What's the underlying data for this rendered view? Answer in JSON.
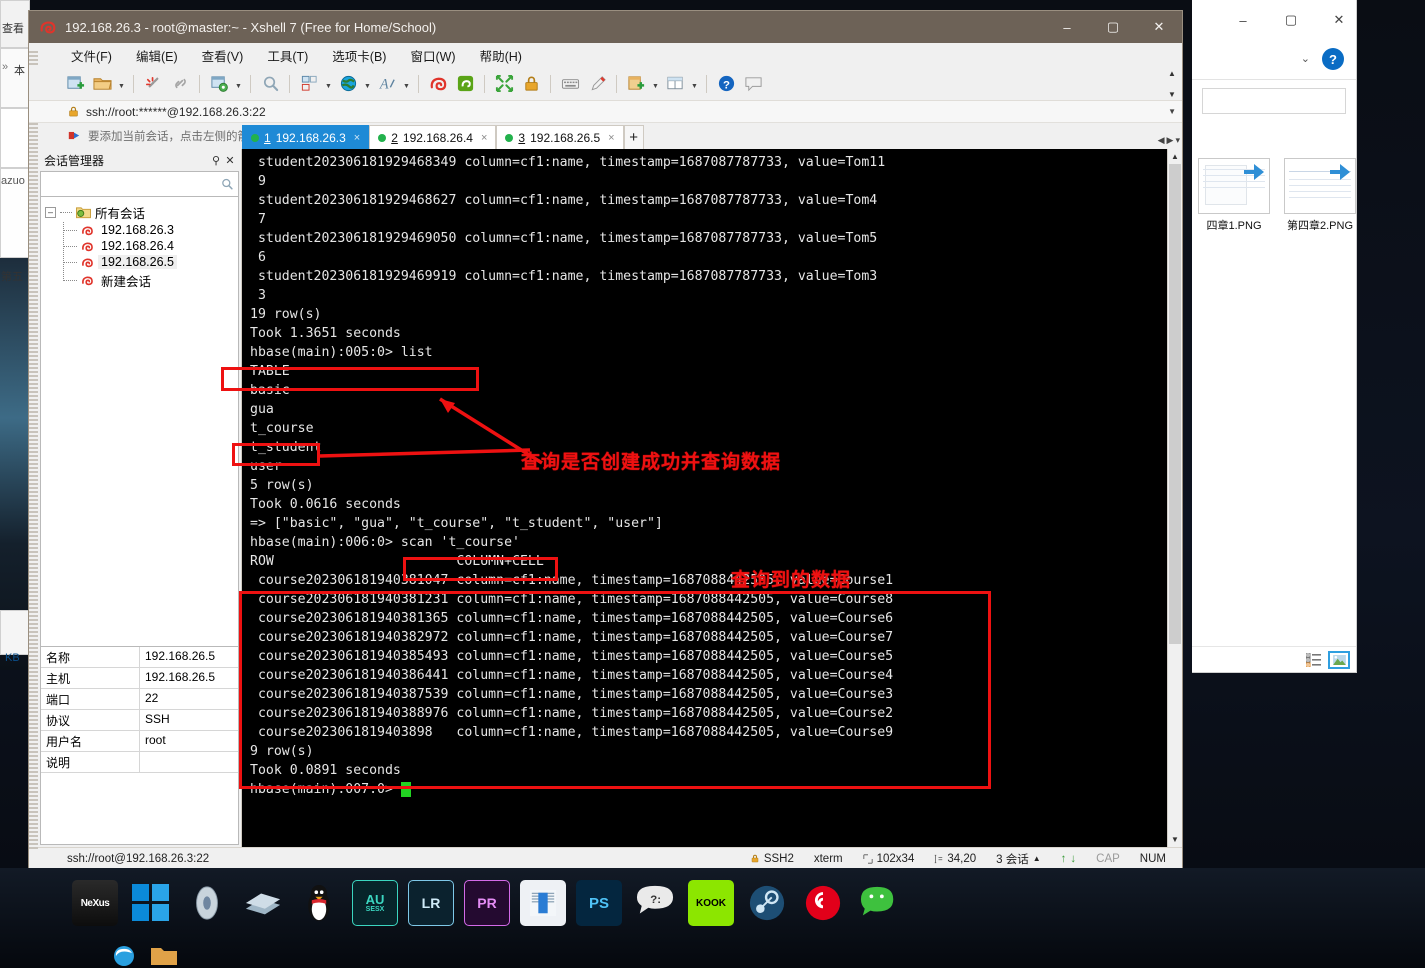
{
  "window": {
    "title": "192.168.26.3 - root@master:~ - Xshell 7 (Free for Home/School)",
    "app_icon": "snail-icon",
    "minimize": "–",
    "maximize": "▢",
    "close": "✕"
  },
  "menubar": [
    {
      "label": "文件(F)",
      "name": "menu-file"
    },
    {
      "label": "编辑(E)",
      "name": "menu-edit"
    },
    {
      "label": "查看(V)",
      "name": "menu-view"
    },
    {
      "label": "工具(T)",
      "name": "menu-tools"
    },
    {
      "label": "选项卡(B)",
      "name": "menu-tabs"
    },
    {
      "label": "窗口(W)",
      "name": "menu-window"
    },
    {
      "label": "帮助(H)",
      "name": "menu-help"
    }
  ],
  "toolbar": {
    "icons": [
      "new-session-icon",
      "open-folder-icon",
      "caret-down-icon",
      "sep",
      "disconnect-icon",
      "link-icon",
      "sep",
      "properties-icon",
      "caret-down-icon",
      "sep",
      "find-icon",
      "sep",
      "layout-icon",
      "caret-down-icon",
      "globe-icon",
      "caret-down-icon",
      "font-icon",
      "caret-down-icon",
      "sep",
      "xshell-icon",
      "xftp-icon",
      "sep",
      "fullscreen-icon",
      "lock-icon",
      "sep",
      "keyboard-icon",
      "highlight-pen-icon",
      "sep",
      "add-tab-icon",
      "caret-down-icon",
      "split-view-icon",
      "caret-down-icon",
      "sep",
      "help-icon",
      "chat-icon"
    ],
    "scroll_up": "▲",
    "scroll_down": "▼"
  },
  "address_bar": {
    "lock_icon": "lock-icon",
    "value": "ssh://root:******@192.168.26.3:22",
    "caret": "▼"
  },
  "tip_bar": {
    "icon": "arrow-flag-icon",
    "text": "要添加当前会话，点击左侧的箭头按钮。"
  },
  "session_manager": {
    "title": "会话管理器",
    "pin_icon": "pin-icon",
    "close_icon": "close-icon",
    "search_placeholder": "",
    "search_value": "",
    "search_icon": "search-icon",
    "tree": {
      "root_label": "所有会话",
      "root_toggle": "–",
      "root_icon": "folder-icon",
      "items": [
        {
          "label": "192.168.26.3",
          "icon": "snail-icon",
          "selected": false
        },
        {
          "label": "192.168.26.4",
          "icon": "snail-icon",
          "selected": false
        },
        {
          "label": "192.168.26.5",
          "icon": "snail-icon",
          "selected": true
        },
        {
          "label": "新建会话",
          "icon": "snail-icon",
          "selected": false
        }
      ]
    },
    "properties": [
      {
        "key": "名称",
        "value": "192.168.26.5"
      },
      {
        "key": "主机",
        "value": "192.168.26.5"
      },
      {
        "key": "端口",
        "value": "22"
      },
      {
        "key": "协议",
        "value": "SSH"
      },
      {
        "key": "用户名",
        "value": "root"
      },
      {
        "key": "说明",
        "value": ""
      }
    ]
  },
  "tabs": [
    {
      "num": "1",
      "label": "192.168.26.3",
      "active": true,
      "close": "×",
      "status": "connected"
    },
    {
      "num": "2",
      "label": "192.168.26.4",
      "active": false,
      "close": "×",
      "status": "connected"
    },
    {
      "num": "3",
      "label": "192.168.26.5",
      "active": false,
      "close": "×",
      "status": "connected"
    }
  ],
  "tab_add": "+",
  "tab_nav_left": "◀",
  "tab_nav_right": "▶",
  "tab_nav_menu": "▾",
  "terminal": {
    "lines": [
      " student202306181929468349 column=cf1:name, timestamp=1687087787733, value=Tom11",
      " 9",
      " student202306181929468627 column=cf1:name, timestamp=1687087787733, value=Tom4",
      " 7",
      " student202306181929469050 column=cf1:name, timestamp=1687087787733, value=Tom5",
      " 6",
      " student202306181929469919 column=cf1:name, timestamp=1687087787733, value=Tom3",
      " 3",
      "19 row(s)",
      "Took 1.3651 seconds",
      "hbase(main):005:0> list",
      "TABLE",
      "basic",
      "gua",
      "t_course",
      "t_student",
      "user",
      "5 row(s)",
      "Took 0.0616 seconds",
      "=> [\"basic\", \"gua\", \"t_course\", \"t_student\", \"user\"]",
      "hbase(main):006:0> scan 't_course'",
      "ROW                       COLUMN+CELL",
      " course202306181940381047 column=cf1:name, timestamp=1687088442505, value=Course1",
      " course202306181940381231 column=cf1:name, timestamp=1687088442505, value=Course8",
      " course202306181940381365 column=cf1:name, timestamp=1687088442505, value=Course6",
      " course202306181940382972 column=cf1:name, timestamp=1687088442505, value=Course7",
      " course202306181940385493 column=cf1:name, timestamp=1687088442505, value=Course5",
      " course202306181940386441 column=cf1:name, timestamp=1687088442505, value=Course4",
      " course202306181940387539 column=cf1:name, timestamp=1687088442505, value=Course3",
      " course202306181940388976 column=cf1:name, timestamp=1687088442505, value=Course2",
      " course2023061819403898   column=cf1:name, timestamp=1687088442505, value=Course9",
      "9 row(s)",
      "Took 0.0891 seconds",
      "hbase(main):007:0> "
    ],
    "cursor": "█",
    "scroll_up": "▲",
    "scroll_down": "▼"
  },
  "annotations": [
    {
      "type": "text",
      "text": "查询是否创建成功并查询数据",
      "name": "annotation-query-created"
    },
    {
      "type": "text",
      "text": "查询到的数据",
      "name": "annotation-queried-data"
    }
  ],
  "status_bar": {
    "path": "ssh://root@192.168.26.3:22",
    "protocol": "SSH2",
    "terminal_type": "xterm",
    "size": "102x34",
    "cursor": "34,20",
    "sessions": "3 会话",
    "sessions_caret": "▲",
    "up_arrow": "↑",
    "down_arrow": "↓",
    "cap": "CAP",
    "num": "NUM",
    "lock_icon": "lock-icon",
    "size_icon": "resize-icon",
    "cursor_icon": "cursor-icon"
  },
  "explorer": {
    "minimize": "–",
    "maximize": "▢",
    "close": "✕",
    "chevron": "⌄",
    "help": "?",
    "files": [
      {
        "label": "四章1.PNG",
        "name": "file-thumb-1"
      },
      {
        "label": "第四章2.PNG",
        "name": "file-thumb-2"
      }
    ],
    "view_details_icon": "details-view-icon",
    "view_thumbs_icon": "thumbnail-view-icon"
  },
  "background_windows": {
    "view_label": "查看",
    "local_label": "本",
    "arrow": "»",
    "kb_label": "KB",
    "chapter_label": "第五",
    "azuo_label": "azuo"
  },
  "taskbar": {
    "dock_items": [
      {
        "name": "nexus-icon",
        "label": "NeXus",
        "color": "#1a1a1a"
      },
      {
        "name": "windows-icon",
        "label": "",
        "color": "#0b8ad9"
      },
      {
        "name": "disk-icon",
        "label": "",
        "color": "#8b9aa8"
      },
      {
        "name": "files-icon",
        "label": "",
        "color": "#6d8494"
      },
      {
        "name": "qq-penguin-icon",
        "label": "",
        "color": "#1b1b1b"
      },
      {
        "name": "audition-icon",
        "label": "AU",
        "color": "#0a2b2b"
      },
      {
        "name": "lightroom-icon",
        "label": "LR",
        "color": "#0d2430"
      },
      {
        "name": "premiere-icon",
        "label": "PR",
        "color": "#2a0a35"
      },
      {
        "name": "word-icon",
        "label": "",
        "color": "#e9edf2"
      },
      {
        "name": "photoshop-icon",
        "label": "PS",
        "color": "#041c34"
      },
      {
        "name": "qq-chat-icon",
        "label": "?:",
        "color": "#e8e8e8"
      },
      {
        "name": "kook-icon",
        "label": "KOOK",
        "color": "#8ce600"
      },
      {
        "name": "steam-icon",
        "label": "",
        "color": "#1b4f7a"
      },
      {
        "name": "netease-music-icon",
        "label": "",
        "color": "#e60026"
      },
      {
        "name": "wechat-icon",
        "label": "",
        "color": "#3ec13e"
      }
    ]
  }
}
